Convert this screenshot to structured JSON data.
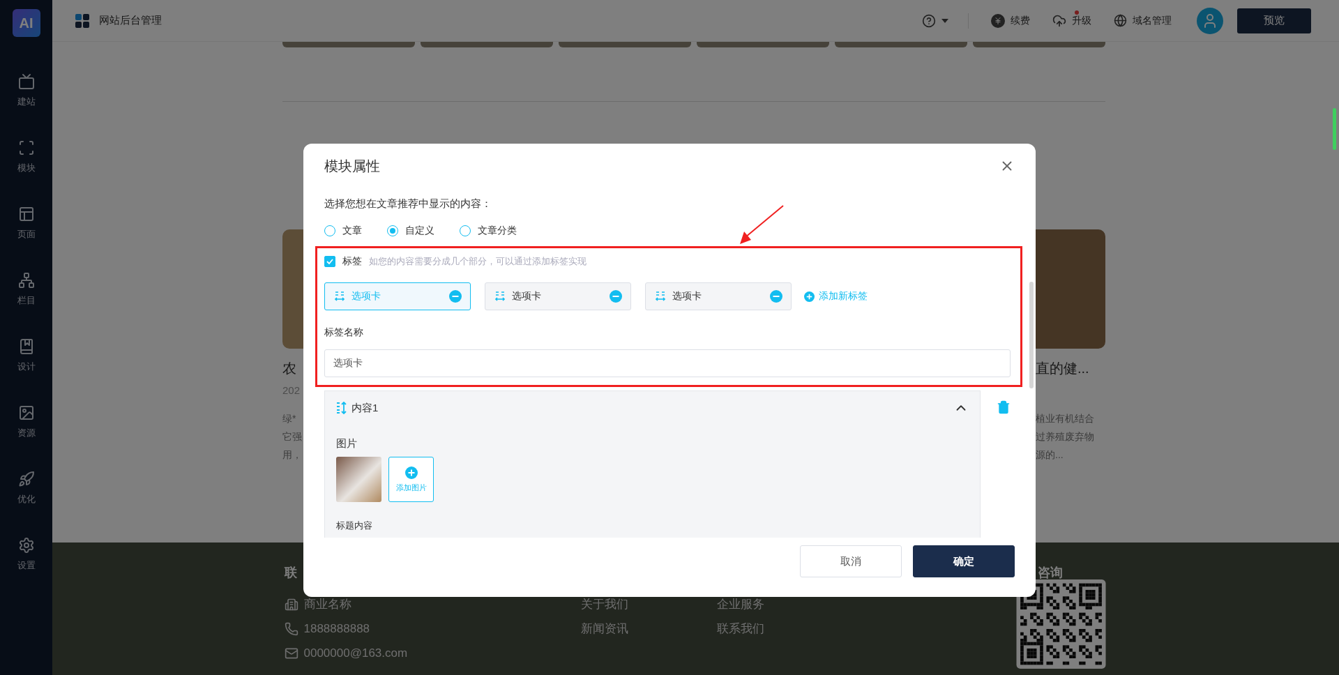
{
  "app": {
    "logo": "AI",
    "title": "网站后台管理"
  },
  "sidebar": [
    {
      "kind": "build",
      "label": "建站"
    },
    {
      "kind": "module",
      "label": "模块"
    },
    {
      "kind": "page",
      "label": "页面"
    },
    {
      "kind": "column",
      "label": "栏目"
    },
    {
      "kind": "design",
      "label": "设计"
    },
    {
      "kind": "resource",
      "label": "资源"
    },
    {
      "kind": "optimize",
      "label": "优化"
    },
    {
      "kind": "settings",
      "label": "设置"
    }
  ],
  "topbar": {
    "actions": [
      {
        "kind": "renew",
        "label": "续费",
        "dot": false
      },
      {
        "kind": "upgrade",
        "label": "升级",
        "dot": true
      },
      {
        "kind": "domain",
        "label": "域名管理",
        "dot": false
      }
    ],
    "preview": "预览"
  },
  "page": {
    "cards": [
      {
        "title": "农",
        "date": "202",
        "lines": [
          "绿*",
          "它强",
          "用，"
        ]
      },
      {
        "title": "直的健...",
        "lines": [
          "植业有机结合",
          "过养殖废弃物",
          "源的..."
        ]
      }
    ],
    "footer": {
      "contact_heading": "联",
      "contacts": [
        {
          "kind": "business",
          "text": "商业名称"
        },
        {
          "kind": "phone",
          "text": "1888888888"
        },
        {
          "kind": "email",
          "text": "0000000@163.com"
        }
      ],
      "links_1": [
        "关于我们",
        "新闻资讯"
      ],
      "links_2": [
        "企业服务",
        "联系我们"
      ],
      "consult_heading": "咨询"
    }
  },
  "modal": {
    "title": "模块属性",
    "prompt": "选择您想在文章推荐中显示的内容：",
    "options": [
      {
        "label": "文章",
        "selected": false
      },
      {
        "label": "自定义",
        "selected": true
      },
      {
        "label": "文章分类",
        "selected": false
      }
    ],
    "tags": {
      "checked": true,
      "label": "标签",
      "hint": "如您的内容需要分成几个部分，可以通过添加标签实现",
      "tabs": [
        {
          "label": "选项卡",
          "selected": true
        },
        {
          "label": "选项卡",
          "selected": false
        },
        {
          "label": "选项卡",
          "selected": false
        }
      ],
      "add": "添加新标签",
      "name_label": "标签名称",
      "name_value": "选项卡"
    },
    "content": {
      "title": "内容1",
      "expanded": true,
      "image_label": "图片",
      "add_image": "添加图片",
      "title_label": "标题内容"
    },
    "cancel": "取消",
    "confirm": "确定"
  }
}
